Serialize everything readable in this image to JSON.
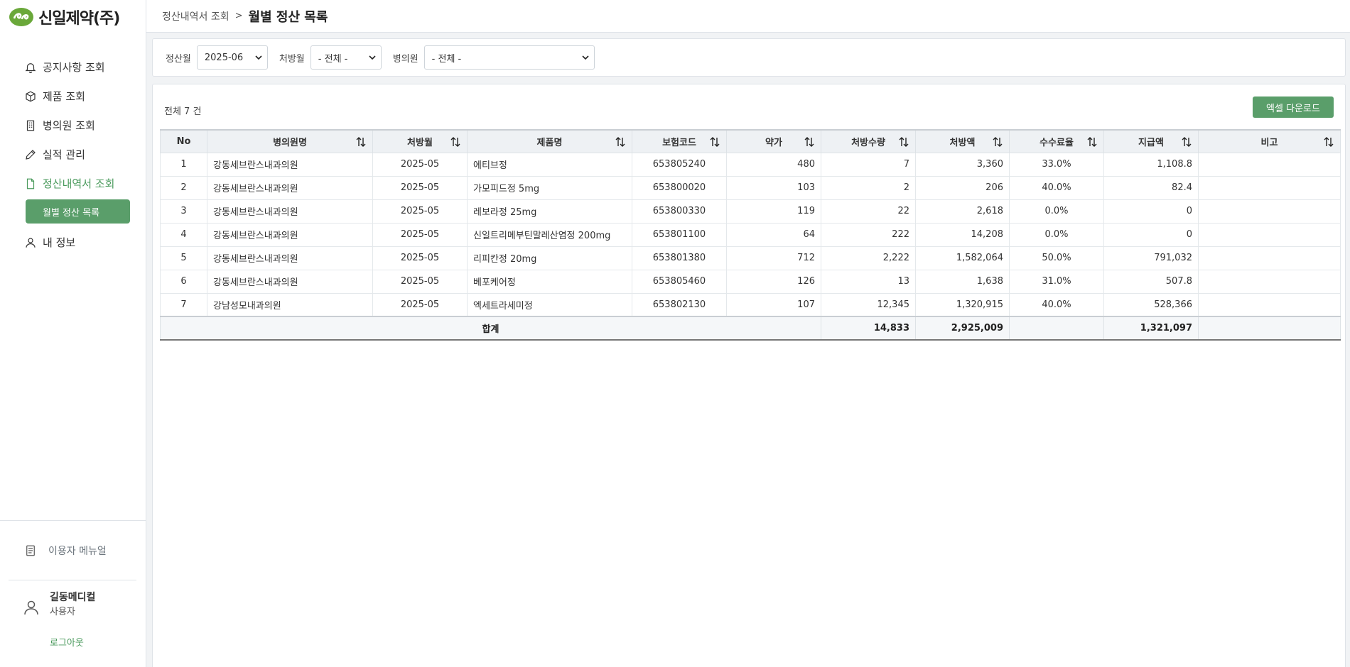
{
  "app": {
    "logo_text": "신일제약(주)"
  },
  "sidebar": {
    "items": [
      {
        "label": "공지사항 조회",
        "icon": "bell-icon"
      },
      {
        "label": "제품 조회",
        "icon": "box-icon"
      },
      {
        "label": "병의원 조회",
        "icon": "building-icon"
      },
      {
        "label": "실적 관리",
        "icon": "pencil-icon"
      },
      {
        "label": "정산내역서 조회",
        "icon": "document-icon",
        "active": true
      }
    ],
    "sub_item": "월별 정산 목록",
    "profile_item": {
      "label": "내 정보",
      "icon": "user-icon"
    },
    "manual_label": "이용자 메뉴얼",
    "user": {
      "name": "길동메디컬",
      "role": "사용자"
    },
    "logout_label": "로그아웃"
  },
  "header": {
    "breadcrumb": "정산내역서 조회",
    "separator": ">",
    "title": "월별 정산 목록"
  },
  "filters": {
    "settle_month_label": "정산월",
    "settle_month_value": "2025-06",
    "rx_month_label": "처방월",
    "rx_month_value": "- 전체 -",
    "hospital_label": "병의원",
    "hospital_value": "- 전체 -"
  },
  "list": {
    "count_text": "전체 7 건",
    "excel_button": "엑셀 다운로드",
    "columns": [
      "No",
      "병의원명",
      "처방월",
      "제품명",
      "보험코드",
      "약가",
      "처방수량",
      "처방액",
      "수수료율",
      "지급액",
      "비고"
    ],
    "rows": [
      {
        "no": "1",
        "hospital": "강동세브란스내과의원",
        "rx_month": "2025-05",
        "product": "에티브정",
        "code": "653805240",
        "price": "480",
        "qty": "7",
        "amount": "3,360",
        "rate": "33.0%",
        "pay": "1,108.8",
        "note": ""
      },
      {
        "no": "2",
        "hospital": "강동세브란스내과의원",
        "rx_month": "2025-05",
        "product": "가모피드정 5mg",
        "code": "653800020",
        "price": "103",
        "qty": "2",
        "amount": "206",
        "rate": "40.0%",
        "pay": "82.4",
        "note": ""
      },
      {
        "no": "3",
        "hospital": "강동세브란스내과의원",
        "rx_month": "2025-05",
        "product": "레보라정 25mg",
        "code": "653800330",
        "price": "119",
        "qty": "22",
        "amount": "2,618",
        "rate": "0.0%",
        "pay": "0",
        "note": ""
      },
      {
        "no": "4",
        "hospital": "강동세브란스내과의원",
        "rx_month": "2025-05",
        "product": "신일트리메부틴말레산염정 200mg",
        "code": "653801100",
        "price": "64",
        "qty": "222",
        "amount": "14,208",
        "rate": "0.0%",
        "pay": "0",
        "note": ""
      },
      {
        "no": "5",
        "hospital": "강동세브란스내과의원",
        "rx_month": "2025-05",
        "product": "리피칸정 20mg",
        "code": "653801380",
        "price": "712",
        "qty": "2,222",
        "amount": "1,582,064",
        "rate": "50.0%",
        "pay": "791,032",
        "note": ""
      },
      {
        "no": "6",
        "hospital": "강동세브란스내과의원",
        "rx_month": "2025-05",
        "product": "베포케어정",
        "code": "653805460",
        "price": "126",
        "qty": "13",
        "amount": "1,638",
        "rate": "31.0%",
        "pay": "507.8",
        "note": ""
      },
      {
        "no": "7",
        "hospital": "강남성모내과의원",
        "rx_month": "2025-05",
        "product": "엑세트라세미정",
        "code": "653802130",
        "price": "107",
        "qty": "12,345",
        "amount": "1,320,915",
        "rate": "40.0%",
        "pay": "528,366",
        "note": ""
      }
    ],
    "total": {
      "label": "합계",
      "qty": "14,833",
      "amount": "2,925,009",
      "pay": "1,321,097"
    }
  },
  "colors": {
    "accent": "#5a9e6a",
    "accent_text": "#4a9a5c",
    "logo_green": "#6aa83a"
  }
}
